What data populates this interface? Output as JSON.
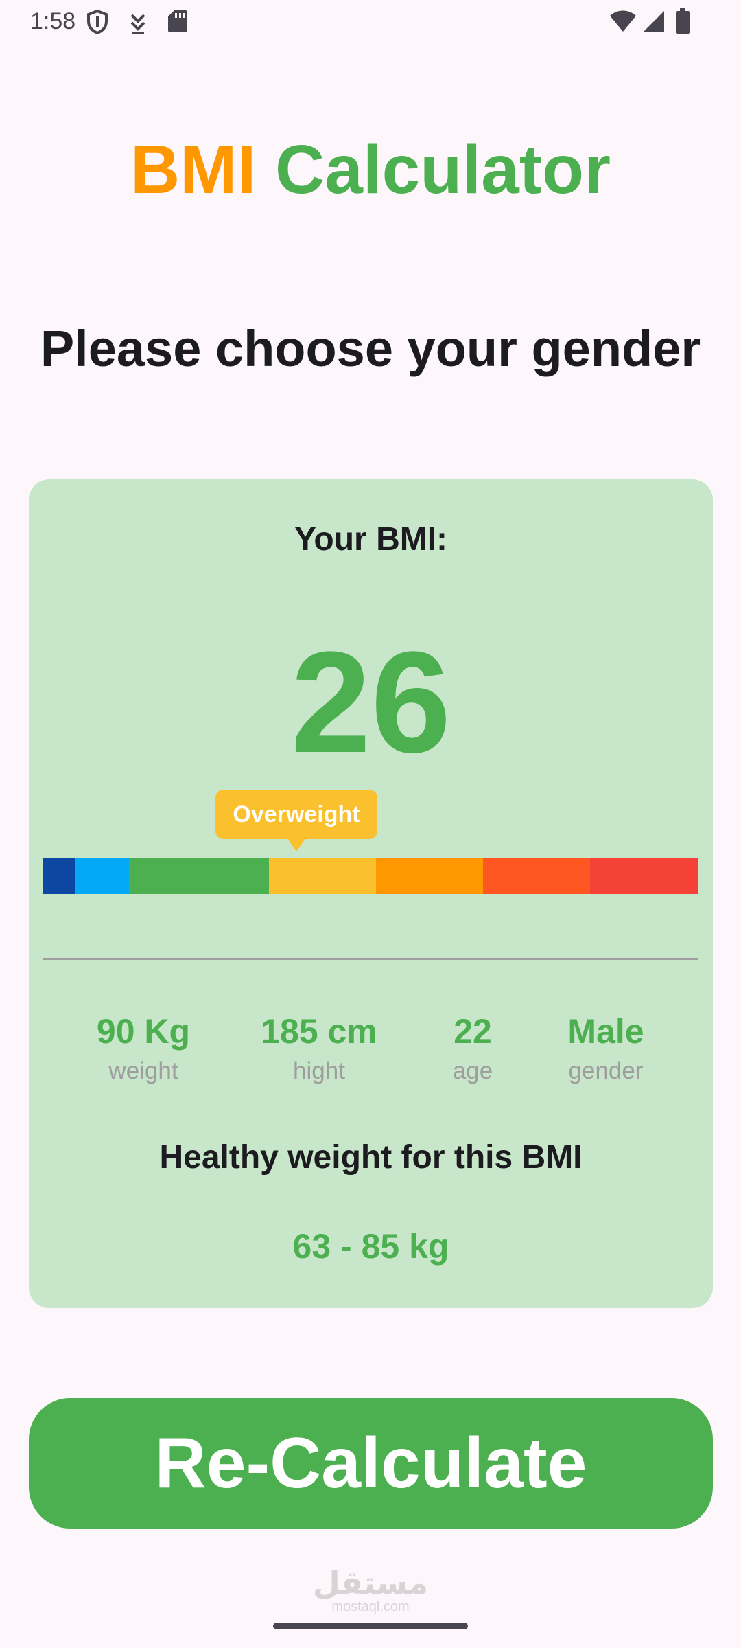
{
  "status_bar": {
    "time": "1:58",
    "icons": [
      "shield-icon",
      "download-arrow-icon",
      "sd-card-icon",
      "wifi-icon",
      "signal-icon",
      "battery-icon"
    ]
  },
  "header": {
    "title_part1": "BMI",
    "title_part2": "Calculator",
    "title_part1_color": "#ff9800",
    "title_part2_color": "#4caf50"
  },
  "prompt": "Please choose your gender",
  "result": {
    "label": "Your BMI:",
    "value": "26",
    "category": "Overweight",
    "scale_colors": [
      "#0d47a1",
      "#03a9f4",
      "#4caf50",
      "#fbc02d",
      "#ff9800",
      "#ff5722",
      "#f44336"
    ],
    "stats": [
      {
        "value": "90 Kg",
        "label": "weight"
      },
      {
        "value": "185 cm",
        "label": "hight"
      },
      {
        "value": "22",
        "label": "age"
      },
      {
        "value": "Male",
        "label": "gender"
      }
    ],
    "healthy_label": "Healthy weight for this BMI",
    "healthy_range": "63 - 85 kg"
  },
  "action": {
    "recalculate_label": "Re-Calculate"
  },
  "watermark": {
    "text": "مستقل",
    "sub": "mostaql.com"
  }
}
